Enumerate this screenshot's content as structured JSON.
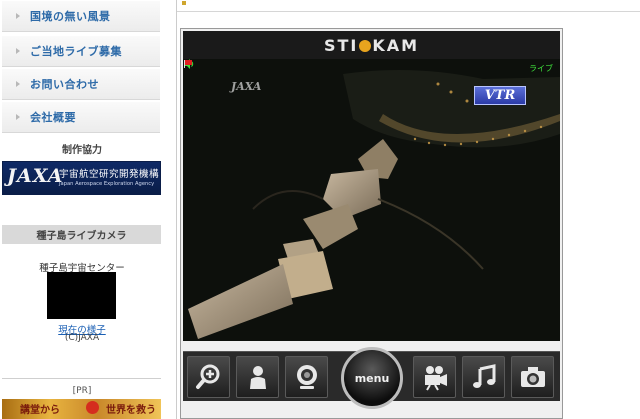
{
  "sidebar": {
    "nav": [
      {
        "label": "国境の無い風景"
      },
      {
        "label": "ご当地ライブ募集"
      },
      {
        "label": "お問い合わせ"
      },
      {
        "label": "会社概要"
      }
    ],
    "cooperation_heading": "制作協力",
    "jaxa_banner": {
      "logo": "JAXA",
      "jp_name": "宇宙航空研究開発機構",
      "en_name": "Japan Aerospace Exploration Agency"
    },
    "camera_heading": "種子島ライブカメラ",
    "center_name": "種子島宇宙センター",
    "current_link": "現在の様子",
    "copyright": "(C)JAXA",
    "pr_label": "[PR]",
    "pr_banner": {
      "left_text": "講堂から",
      "right_text": "世界を救う"
    }
  },
  "player": {
    "brand": "STICKAM",
    "live_label": "ライブ",
    "vtr_badge": "VTR",
    "watermark": "JAXA",
    "menu_label": "menu",
    "controls_left": [
      {
        "icon": "zoom-in-icon"
      },
      {
        "icon": "user-icon"
      },
      {
        "icon": "webcam-icon"
      }
    ],
    "controls_right": [
      {
        "icon": "video-camera-icon"
      },
      {
        "icon": "music-note-icon"
      },
      {
        "icon": "camera-icon"
      }
    ]
  },
  "colors": {
    "nav_text": "#2d6aa8",
    "jaxa_blue": "#0f2a66",
    "live_green": "#3fe13c",
    "vtr_blue": "#3b4ec0",
    "menu_ring": "#bdbdbd"
  }
}
